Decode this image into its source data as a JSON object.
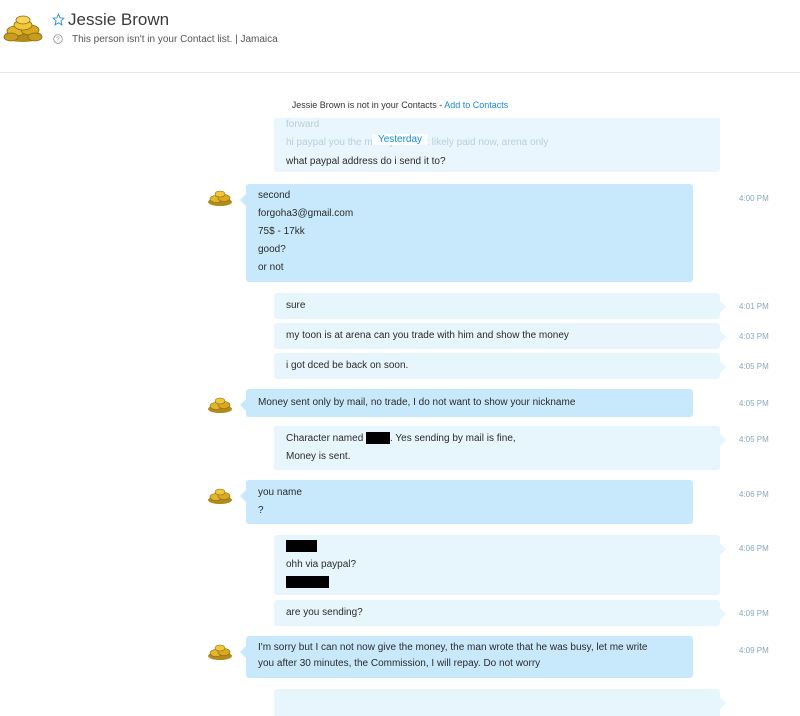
{
  "header": {
    "contact_name": "Jessie Brown",
    "status": "This person isn't in your Contact list.  |  Jamaica"
  },
  "notice": {
    "text": "Jessie Brown is not in your Contacts - ",
    "link": "Add to Contacts"
  },
  "day_divider": "Yesterday",
  "faded_top": {
    "ghost_line_1": "forward",
    "ghost_line_2": "hi paypal you the money is most likely paid now, arena only",
    "last_line": "what paypal address do i send it to?"
  },
  "messages": [
    {
      "dir": "in",
      "lines": [
        "second",
        "forgoha3@gmail.com",
        "75$ - 17kk",
        "good?",
        "or not"
      ],
      "time": "4:00 PM"
    },
    {
      "dir": "out",
      "lines": [
        "sure"
      ],
      "time": "4:01 PM"
    },
    {
      "dir": "out",
      "lines": [
        "my toon is at arena can you trade with him and show the money"
      ],
      "time": "4:03 PM"
    },
    {
      "dir": "out",
      "lines": [
        "i got dced be back on soon."
      ],
      "time": "4:05 PM"
    },
    {
      "dir": "in",
      "lines": [
        "Money sent only by mail, no trade, I do not want to show your nickname"
      ],
      "time": "4:05 PM"
    },
    {
      "dir": "out",
      "lines": [
        "Character named ",
        ". Yes sending by mail is fine,",
        "Money is sent."
      ],
      "time": "4:05 PM"
    },
    {
      "dir": "in",
      "lines": [
        "you name",
        "?"
      ],
      "time": "4:06 PM"
    },
    {
      "dir": "out",
      "lines": [
        "ohh via paypal?"
      ],
      "time": "4:06 PM"
    },
    {
      "dir": "out",
      "lines": [
        "are you sending?"
      ],
      "time": "4:09 PM"
    },
    {
      "dir": "in",
      "lines": [
        "I'm sorry but I can not now give the money, the man wrote that he was busy, let me write",
        "you after 30 minutes, the Commission, I will repay. Do not worry"
      ],
      "time": "4:09 PM"
    }
  ],
  "colors": {
    "incoming_bubble": "#c8e9fb",
    "outgoing_bubble": "#e7f5fd",
    "link": "#1a8ad4",
    "timestamp": "#8aa7b8"
  },
  "icons": {
    "avatar": "gold-coins-avatar",
    "favorite": "star-icon",
    "help": "question-circle-icon"
  }
}
